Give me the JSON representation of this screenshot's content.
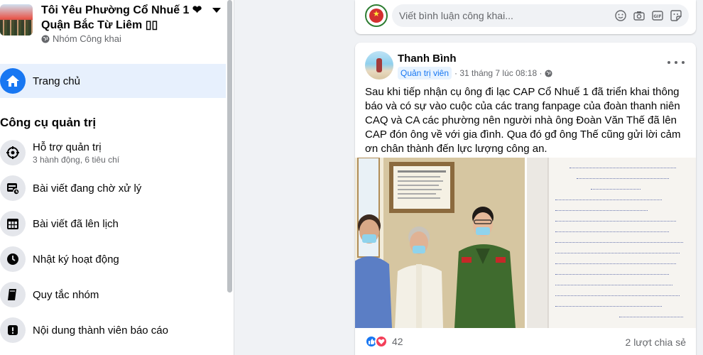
{
  "group": {
    "title": "Tôi Yêu Phường Cổ Nhuế 1 ❤ Quận Bắc Từ Liêm ▯▯",
    "privacy": "Nhóm Công khai"
  },
  "sidebar": {
    "home_label": "Trang chủ",
    "section_title": "Công cụ quản trị",
    "admin_items": [
      {
        "label": "Hỗ trợ quản trị",
        "sub": "3 hành động, 6 tiêu chí",
        "icon": "admin-assist-icon"
      },
      {
        "label": "Bài viết đang chờ xử lý",
        "sub": "",
        "icon": "pending-posts-icon"
      },
      {
        "label": "Bài viết đã lên lịch",
        "sub": "",
        "icon": "calendar-icon"
      },
      {
        "label": "Nhật ký hoạt động",
        "sub": "",
        "icon": "clock-icon"
      },
      {
        "label": "Quy tắc nhóm",
        "sub": "",
        "icon": "book-icon"
      },
      {
        "label": "Nội dung thành viên báo cáo",
        "sub": "",
        "icon": "report-icon"
      }
    ]
  },
  "comment_box": {
    "placeholder": "Viết bình luận công khai..."
  },
  "post": {
    "author": "Thanh Bình",
    "role": "Quản trị viên",
    "timestamp": "· 31 tháng 7 lúc 08:18 ·",
    "text": "Sau khi tiếp nhận cụ ông đi lạc CAP Cổ Nhuế 1 đã triển khai thông báo và có sự vào cuộc của các trang fanpage của đoàn thanh niên CAQ và CA các phường nên người nhà ông Đoàn Văn Thế đã lên CAP đón ông về với gia đình. Qua đó gđ ông Thế cũng gửi lời cảm ơn chân thành đến lực lượng công an.",
    "reaction_count": "42",
    "share_count": "2 lượt chia sẻ"
  },
  "colors": {
    "brand_blue": "#1877f2",
    "love_red": "#f33e58",
    "home_highlight": "#e7f0fd"
  }
}
